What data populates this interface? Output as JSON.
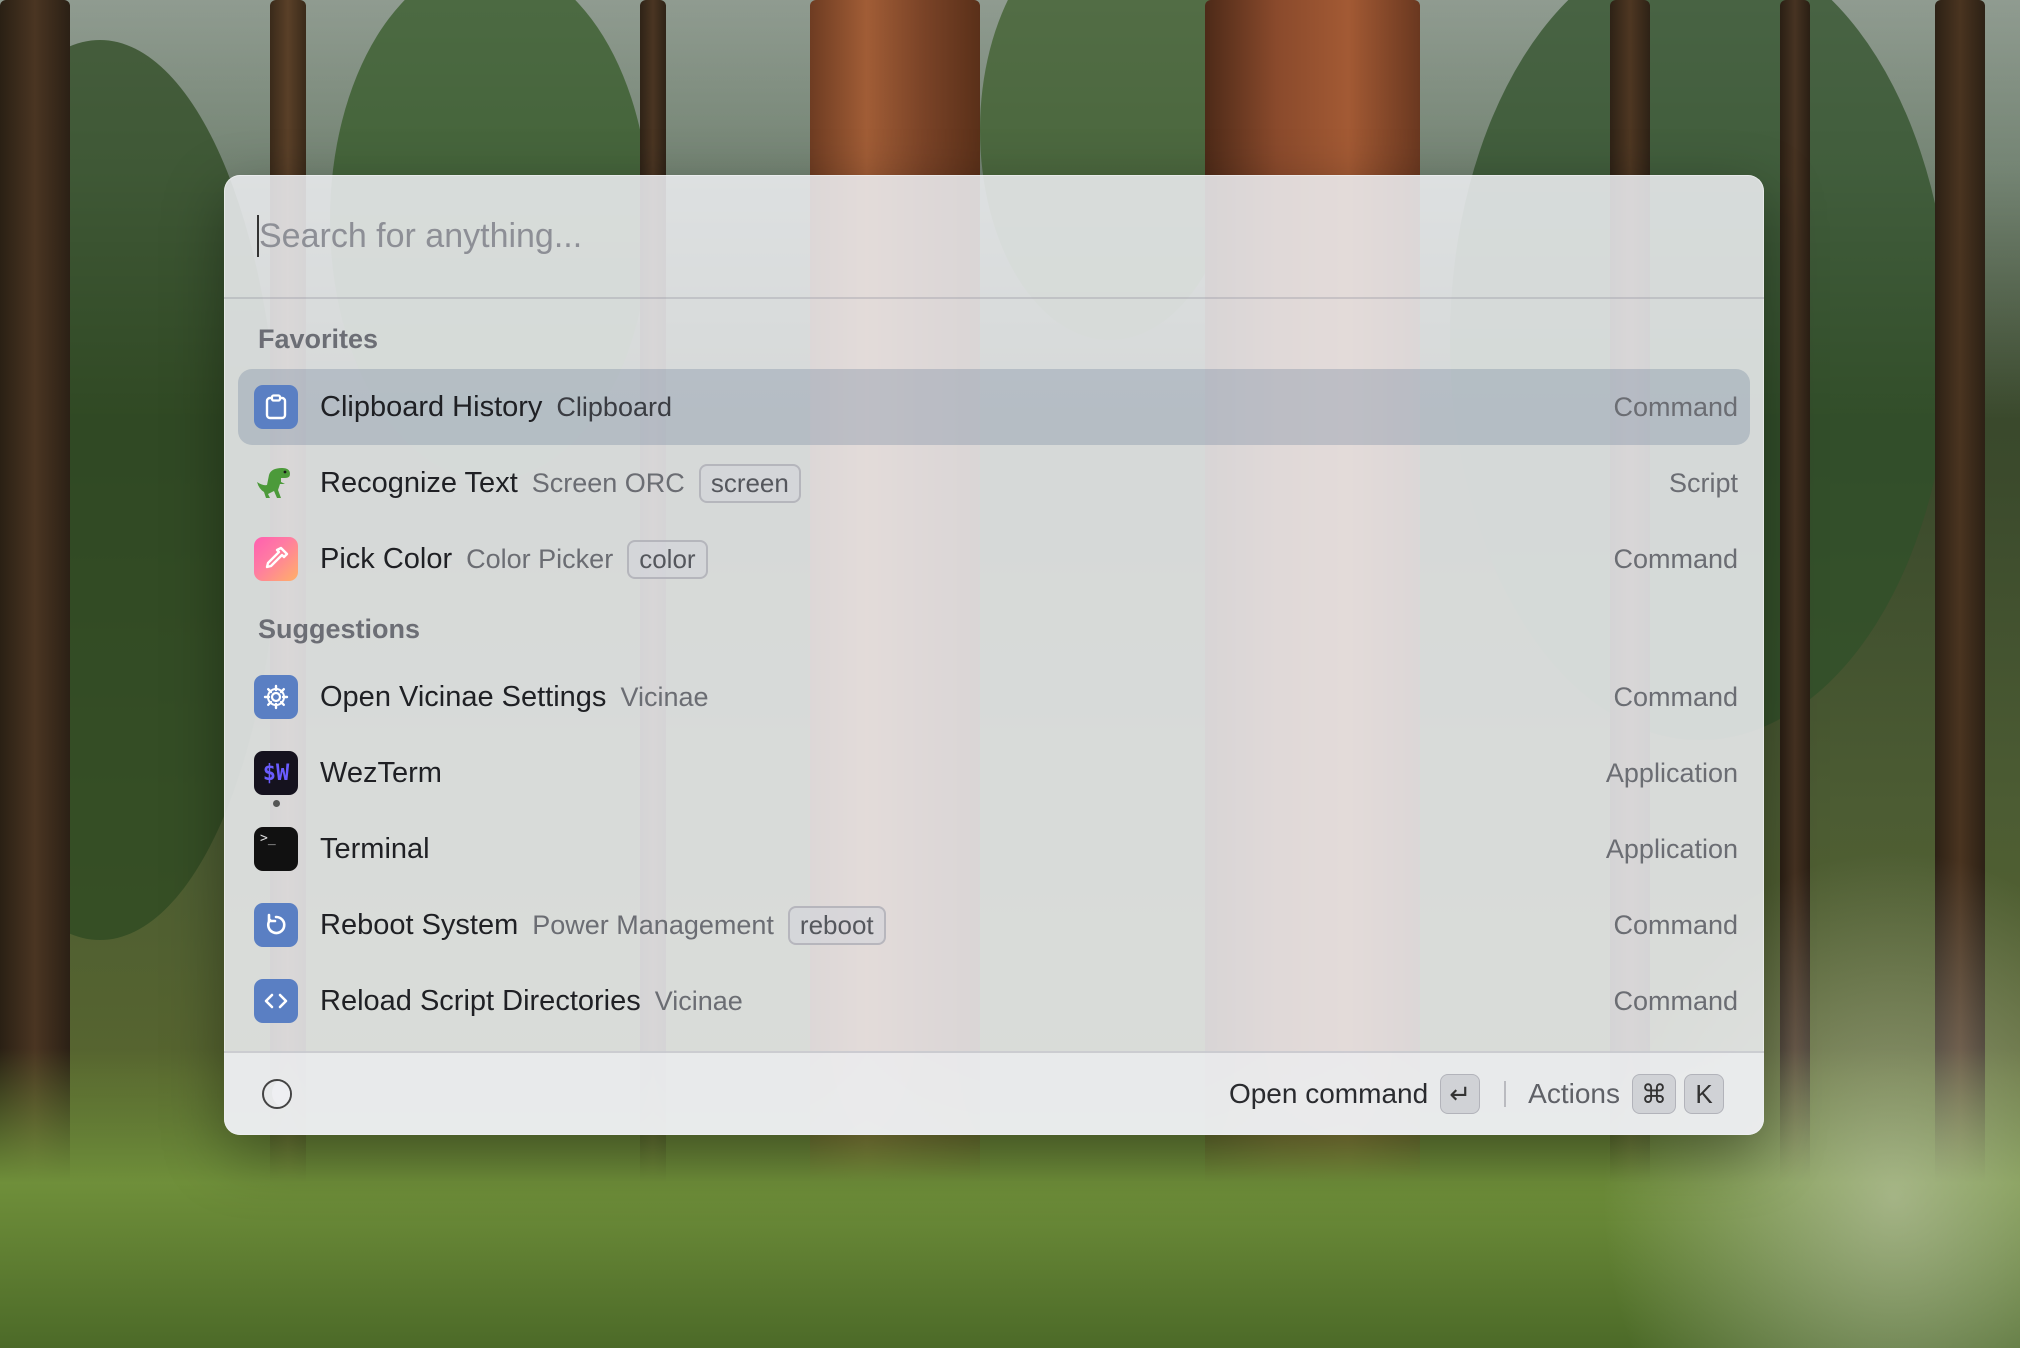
{
  "search": {
    "placeholder": "Search for anything..."
  },
  "sections": {
    "favorites": "Favorites",
    "suggestions": "Suggestions"
  },
  "items": [
    {
      "title": "Clipboard History",
      "subtitle": "Clipboard",
      "tag": "",
      "kind": "Command",
      "icon": "clipboard-icon",
      "selected": true
    },
    {
      "title": "Recognize Text",
      "subtitle": "Screen ORC",
      "tag": "screen",
      "kind": "Script",
      "icon": "dinosaur-icon"
    },
    {
      "title": "Pick Color",
      "subtitle": "Color Picker",
      "tag": "color",
      "kind": "Command",
      "icon": "color-picker-icon"
    },
    {
      "title": "Open Vicinae Settings",
      "subtitle": "Vicinae",
      "tag": "",
      "kind": "Command",
      "icon": "gear-icon"
    },
    {
      "title": "WezTerm",
      "subtitle": "",
      "tag": "",
      "kind": "Application",
      "icon": "wezterm-icon",
      "icon_text": "$W"
    },
    {
      "title": "Terminal",
      "subtitle": "",
      "tag": "",
      "kind": "Application",
      "icon": "terminal-icon",
      "icon_text": ">_"
    },
    {
      "title": "Reboot System",
      "subtitle": "Power Management",
      "tag": "reboot",
      "kind": "Command",
      "icon": "reboot-icon"
    },
    {
      "title": "Reload Script Directories",
      "subtitle": "Vicinae",
      "tag": "",
      "kind": "Command",
      "icon": "code-icon"
    }
  ],
  "footer": {
    "primary_action": "Open command",
    "primary_key": "↵",
    "actions_label": "Actions",
    "actions_keys": [
      "⌘",
      "K"
    ]
  },
  "colors": {
    "accent_blue": "#5a7fc3",
    "selected_row": "#788aa0"
  }
}
